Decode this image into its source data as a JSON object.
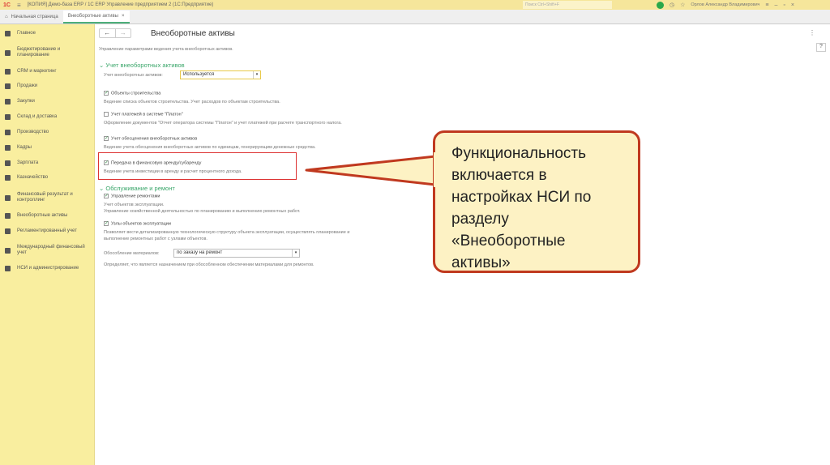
{
  "titlebar": {
    "logo": "1С",
    "title": "[КОПИЯ] Демо-база ERP / 1С ERP Управление предприятием 2  (1С:Предприятие)",
    "search_placeholder": "Поиск Ctrl+Shift+F",
    "user": "Орлов Александр Владимирович"
  },
  "tabs": [
    {
      "label": "Начальная страница"
    },
    {
      "label": "Внеоборотные активы",
      "close": "×"
    }
  ],
  "sidebar": {
    "items": [
      "Главное",
      "Бюджетирование и планирование",
      "CRM и маркетинг",
      "Продажи",
      "Закупки",
      "Склад и доставка",
      "Производство",
      "Кадры",
      "Зарплата",
      "Казначейство",
      "Финансовый результат и контроллинг",
      "Внеоборотные активы",
      "Регламентированный учет",
      "Международный финансовый учет",
      "НСИ и администрирование"
    ]
  },
  "main": {
    "back": "←",
    "forward": "→",
    "title": "Внеоборотные активы",
    "more": "⋮",
    "help": "?",
    "description": "Управление параметрами ведения учета внеоборотных активов.",
    "section1": "Учет внеоборотных активов",
    "field1_label": "Учет внеоборотных активов:",
    "field1_value": "Используется",
    "options": [
      {
        "label": "Объекты строительства",
        "checked": true,
        "desc": "Ведение списка объектов строительства. Учет расходов по объектам строительства."
      },
      {
        "label": "Учет платежей в системе \"Платон\"",
        "checked": false,
        "desc": "Оформление документов \"Отчет оператора системы \"Платон\" и учет платежей при расчете транспортного налога."
      },
      {
        "label": "Учет обесценения внеоборотных активов",
        "checked": true,
        "desc": "Ведение учета обесценения внеоборотных активов по единицам, генерирующим денежные средства."
      },
      {
        "label": "Передача в финансовую аренду/субаренду",
        "checked": true,
        "desc": "Ведение учета инвестиции в аренду и расчет процентного дохода."
      }
    ],
    "section2": "Обслуживание и ремонт",
    "options2": [
      {
        "label": "Управление ремонтами",
        "checked": true,
        "desc": "Учет объектов эксплуатации.",
        "desc2": "Управление хозяйственной деятельностью по планированию и выполнению ремонтных работ."
      },
      {
        "label": "Узлы объектов эксплуатации",
        "checked": true,
        "desc": "Позволяет вести детализированную технологическую структуру объекта эксплуатации, осуществлять планирование и",
        "desc2": "выполнение ремонтных работ с узлами объектов."
      }
    ],
    "field2_label": "Обособление материалов:",
    "field2_value": "по заказу на ремонт",
    "field2_desc": "Определяет, что является назначением при обособленном обеспечении материалами для ремонтов."
  },
  "callout": {
    "text": "Функциональность включается в настройках НСИ по разделу «Внеоборотные активы»"
  }
}
